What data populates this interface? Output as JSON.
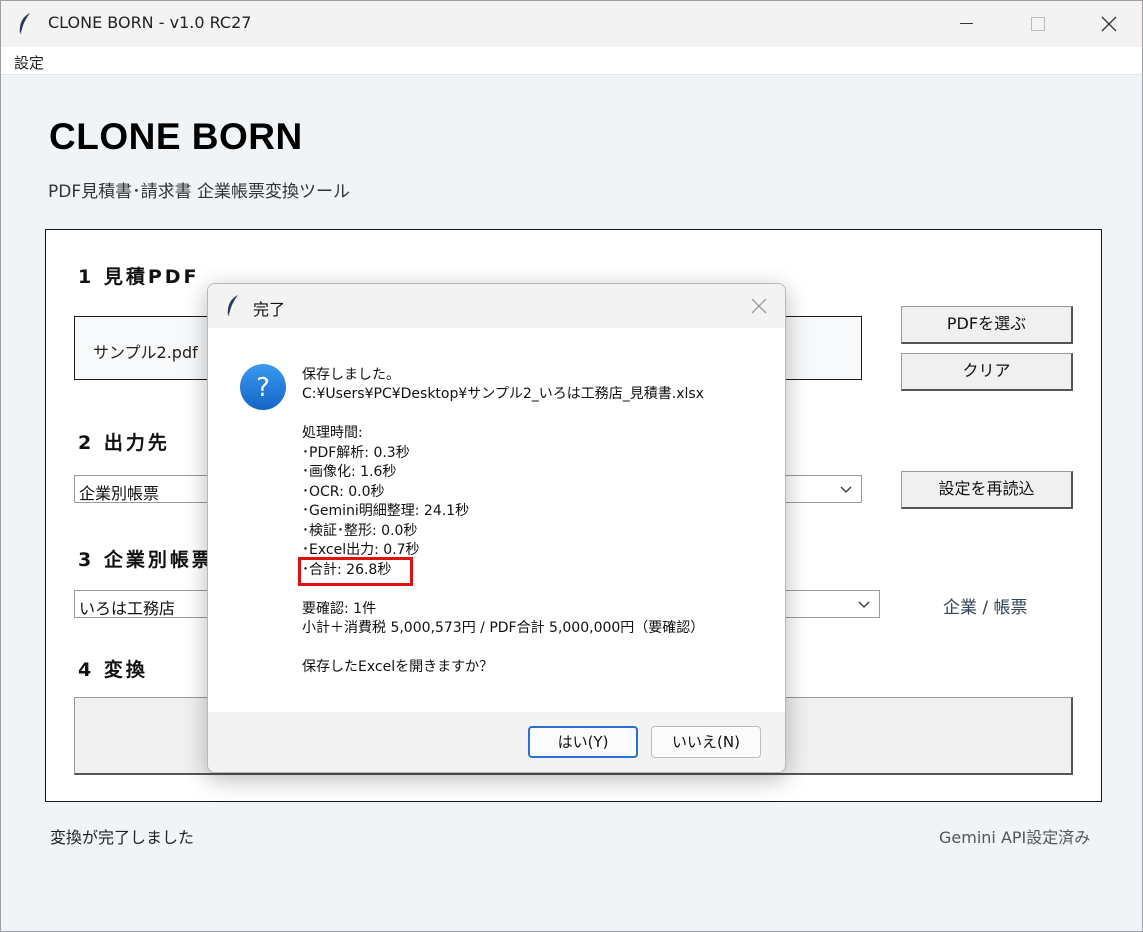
{
  "window": {
    "title": "CLONE BORN - v1.0 RC27"
  },
  "menu": {
    "items": [
      "設定"
    ]
  },
  "header": {
    "title": "CLONE BORN",
    "subtitle": "PDF見積書･請求書 企業帳票変換ツール"
  },
  "sections": {
    "pdf": {
      "title": "1 見積PDF",
      "filename": "サンプル2.pdf",
      "choose_label": "PDFを選ぶ",
      "clear_label": "クリア"
    },
    "output": {
      "title": "2 出力先",
      "selected": "企業別帳票",
      "reload_label": "設定を再読込"
    },
    "template": {
      "title": "3 企業別帳票",
      "selected": "いろは工務店",
      "link_label": "企業 / 帳票"
    },
    "convert": {
      "title": "4 変換"
    }
  },
  "status": {
    "left": "変換が完了しました",
    "right": "Gemini API設定済み"
  },
  "dialog": {
    "title": "完了",
    "lines": {
      "saved": "保存しました。",
      "path": "C:¥Users¥PC¥Desktop¥サンプル2_いろは工務店_見積書.xlsx",
      "time_header": "処理時間:",
      "t1": "･PDF解析: 0.3秒",
      "t2": "･画像化: 1.6秒",
      "t3": "･OCR: 0.0秒",
      "t4": "･Gemini明細整理: 24.1秒",
      "t5": "･検証･整形: 0.0秒",
      "t6": "･Excel出力: 0.7秒",
      "t7": "･合計: 26.8秒",
      "check_header": "要確認: 1件",
      "check_detail": "小計＋消費税 5,000,573円 / PDF合計 5,000,000円（要確認）",
      "question": "保存したExcelを開きますか？"
    },
    "yes_label": "はい(Y)",
    "no_label": "いいえ(N)"
  },
  "colors": {
    "highlight": "#e01010",
    "question_icon": "#1f7fd8",
    "focus_border": "#2a6fd1"
  }
}
